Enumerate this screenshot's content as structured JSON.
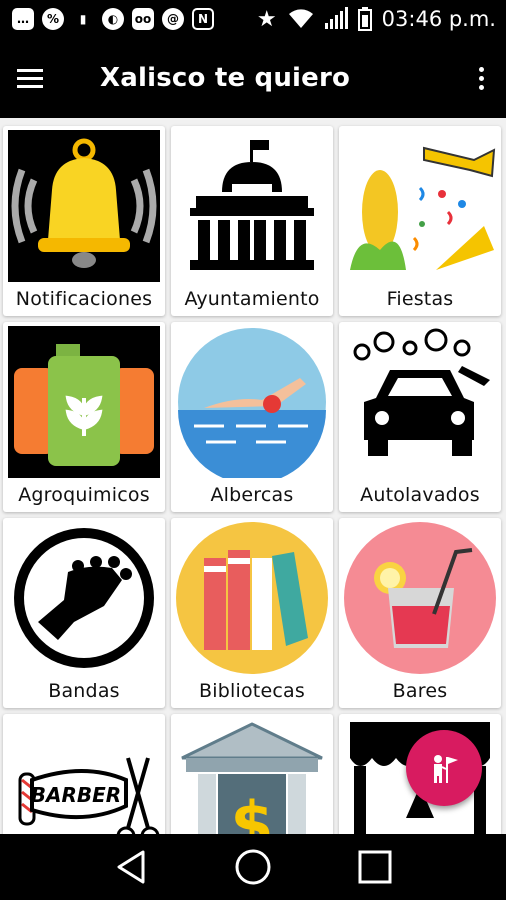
{
  "status_bar": {
    "time": "03:46 p.m.",
    "icons": [
      "chat-icon",
      "percent-icon",
      "battery-saver-icon",
      "ball-icon",
      "voicemail-icon",
      "at-icon",
      "nfc-icon",
      "star-icon",
      "wifi-icon",
      "signal-icon",
      "battery-icon"
    ]
  },
  "app_bar": {
    "title": "Xalisco te quiero"
  },
  "grid": {
    "items": [
      {
        "label": "Notificaciones",
        "icon": "bell-icon"
      },
      {
        "label": "Ayuntamiento",
        "icon": "city-hall-icon"
      },
      {
        "label": "Fiestas",
        "icon": "party-icon"
      },
      {
        "label": "Agroquimicos",
        "icon": "agrochemical-icon"
      },
      {
        "label": "Albercas",
        "icon": "swimmer-icon"
      },
      {
        "label": "Autolavados",
        "icon": "car-wash-icon"
      },
      {
        "label": "Bandas",
        "icon": "guitar-head-icon"
      },
      {
        "label": "Bibliotecas",
        "icon": "books-icon"
      },
      {
        "label": "Bares",
        "icon": "drink-icon"
      },
      {
        "label": "",
        "icon": "barber-icon"
      },
      {
        "label": "",
        "icon": "bank-icon"
      },
      {
        "label": "",
        "icon": "store-icon"
      }
    ]
  },
  "fab": {
    "icon": "user-flag-icon"
  },
  "nav": {
    "icons": [
      "back-icon",
      "home-icon",
      "recents-icon"
    ]
  },
  "colors": {
    "app_bar": "#000000",
    "fab": "#d81b60",
    "background": "#f1f1f1"
  }
}
